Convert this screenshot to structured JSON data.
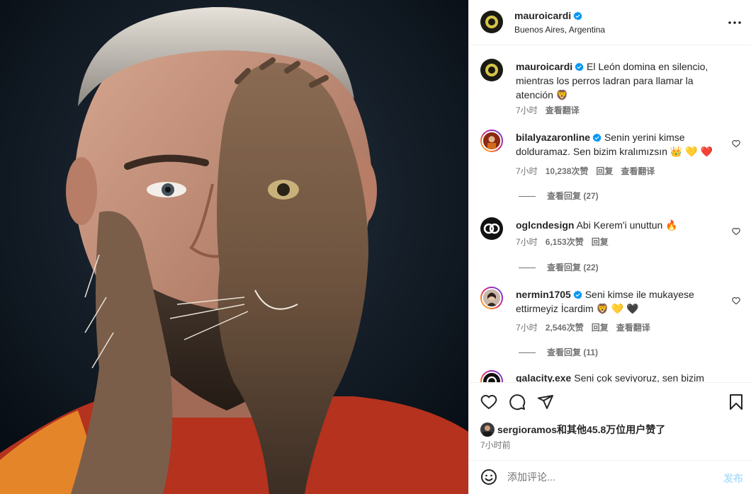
{
  "post": {
    "username": "mauroicardi",
    "location": "Buenos Aires, Argentina"
  },
  "caption": {
    "username": "mauroicardi",
    "text": "El León domina en silencio, mientras los perros ladran para llamar la atención 🦁",
    "time": "7小时",
    "translate": "查看翻译"
  },
  "comments": [
    {
      "username": "bilalyazaronline",
      "verified": true,
      "text": "Senin yerini kimse dolduramaz. Sen bizim kralımızsın 👑 💛 ❤️",
      "time": "7小时",
      "likes": "10,238次赞",
      "reply": "回复",
      "translate": "查看翻译",
      "view_replies": "查看回复 (27)"
    },
    {
      "username": "oglcndesign",
      "verified": false,
      "text": "Abi Kerem'i unuttun 🔥",
      "time": "7小时",
      "likes": "6,153次赞",
      "reply": "回复",
      "view_replies": "查看回复 (22)"
    },
    {
      "username": "nermin1705",
      "verified": true,
      "text": "Seni kimse ile mukayese ettirmeyiz İcardim 🦁 💛 🖤",
      "time": "7小时",
      "likes": "2,546次赞",
      "reply": "回复",
      "translate": "查看翻译",
      "view_replies": "查看回复 (11)"
    },
    {
      "username": "galacity.exe",
      "verified": false,
      "text": "Seni çok seviyoruz, sen bizim"
    }
  ],
  "likes_line": {
    "user": "sergioramos",
    "text": "和其他45.8万位用户赞了"
  },
  "post_time": "7小时前",
  "composer": {
    "placeholder": "添加评论...",
    "post_label": "发布"
  },
  "colors": {
    "verified": "#0095f6",
    "text": "#262626",
    "secondary": "#737373",
    "post_disabled": "#b2dffc"
  },
  "icons": [
    "more-icon",
    "heart-icon",
    "comment-icon",
    "share-icon",
    "bookmark-icon",
    "emoji-icon",
    "verified-icon"
  ]
}
